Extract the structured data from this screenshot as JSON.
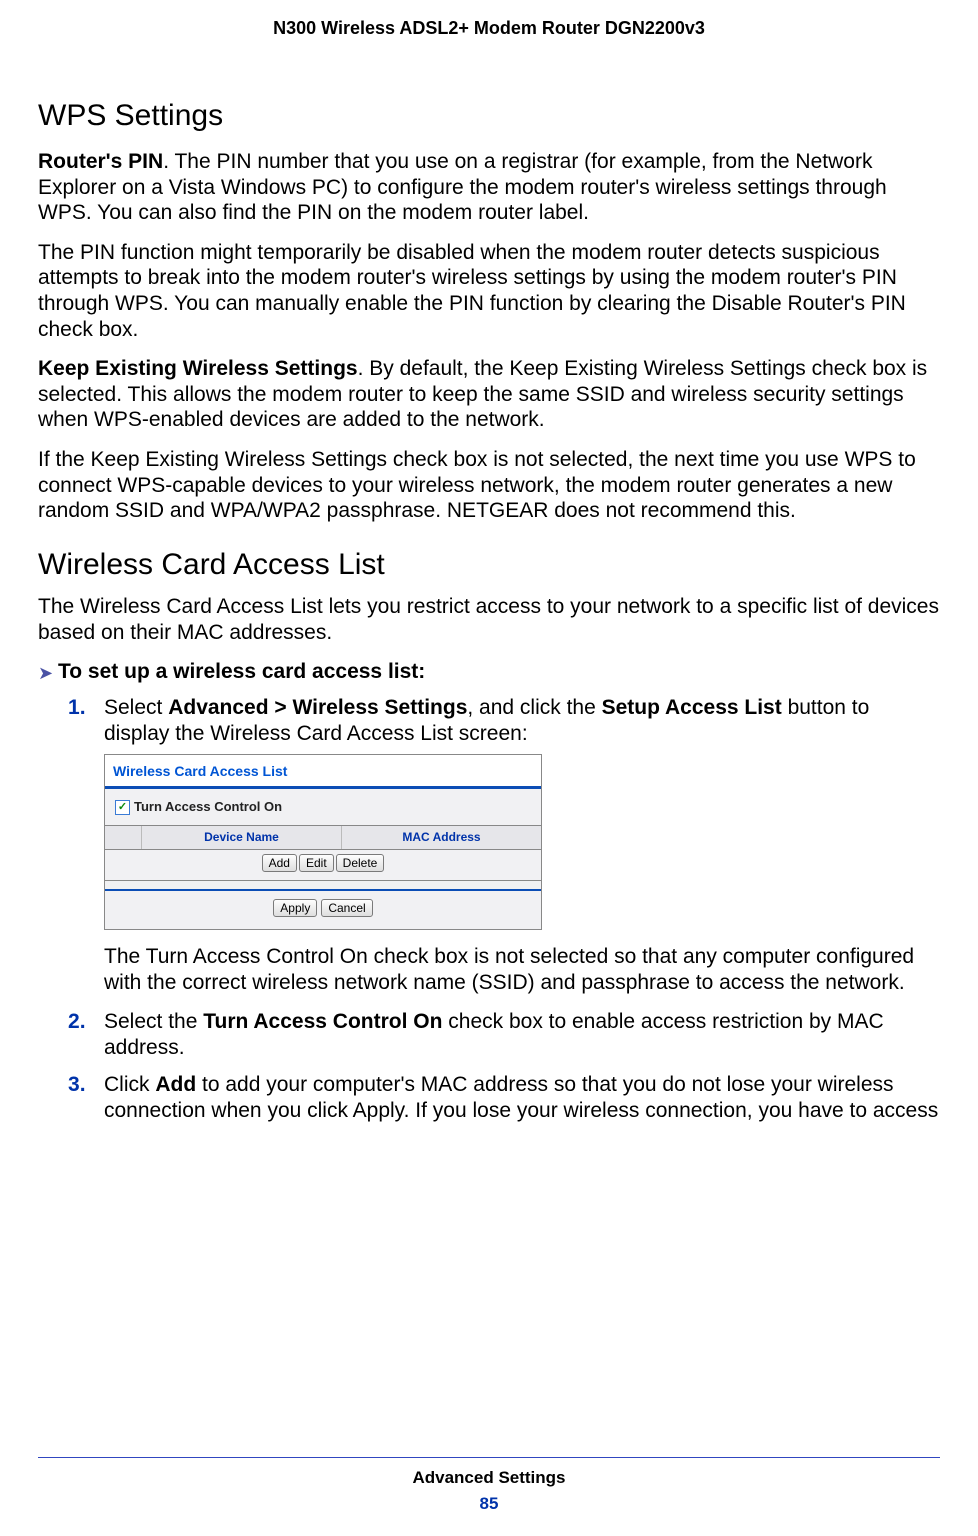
{
  "header": {
    "product": "N300 Wireless ADSL2+ Modem Router DGN2200v3"
  },
  "sections": {
    "wps_heading": "WPS Settings",
    "p1_bold": "Router's PIN",
    "p1_rest": ". The PIN number that you use on a registrar (for example, from the Network Explorer on a Vista Windows PC) to configure the modem router's wireless settings through WPS. You can also find the PIN on the modem router label.",
    "p2": "The PIN function might temporarily be disabled when the modem router detects suspicious attempts to break into the modem router's wireless settings by using the modem router's PIN through WPS. You can manually enable the PIN function by clearing the Disable Router's PIN check box.",
    "p3_bold": "Keep Existing Wireless Settings",
    "p3_rest": ". By default, the Keep Existing Wireless Settings check box is selected. This allows the modem router to keep the same SSID and wireless security settings when WPS-enabled devices are added to the network.",
    "p4": "If the Keep Existing Wireless Settings check box is not selected, the next time you use WPS to connect WPS-capable devices to your wireless network, the modem router generates a new random SSID and WPA/WPA2 passphrase. NETGEAR does not recommend this.",
    "wcal_heading": "Wireless Card Access List",
    "wcal_intro": "The Wireless Card Access List lets you restrict access to your network to a specific list of devices based on their MAC addresses.",
    "proc_title": "To set up a wireless card access list:",
    "step1_a": "Select ",
    "step1_b": "Advanced > Wireless Settings",
    "step1_c": ", and click the ",
    "step1_d": "Setup Access List",
    "step1_e": " button to display the Wireless Card Access List screen:",
    "step1_after": "The Turn Access Control On check box is not selected so that any computer configured with the correct wireless network name (SSID) and passphrase to access the network.",
    "step2_a": "Select the ",
    "step2_b": "Turn Access Control On",
    "step2_c": " check box to enable access restriction by MAC address.",
    "step3_a": "Click ",
    "step3_b": "Add",
    "step3_c": " to add your computer's MAC address so that you do not lose your wireless connection when you click Apply. If you lose your wireless connection, you have to access"
  },
  "acl": {
    "title": "Wireless Card Access List",
    "checkbox_label": "Turn Access Control On",
    "col_device": "Device Name",
    "col_mac": "MAC Address",
    "btn_add": "Add",
    "btn_edit": "Edit",
    "btn_delete": "Delete",
    "btn_apply": "Apply",
    "btn_cancel": "Cancel"
  },
  "footer": {
    "section": "Advanced Settings",
    "page": "85"
  }
}
